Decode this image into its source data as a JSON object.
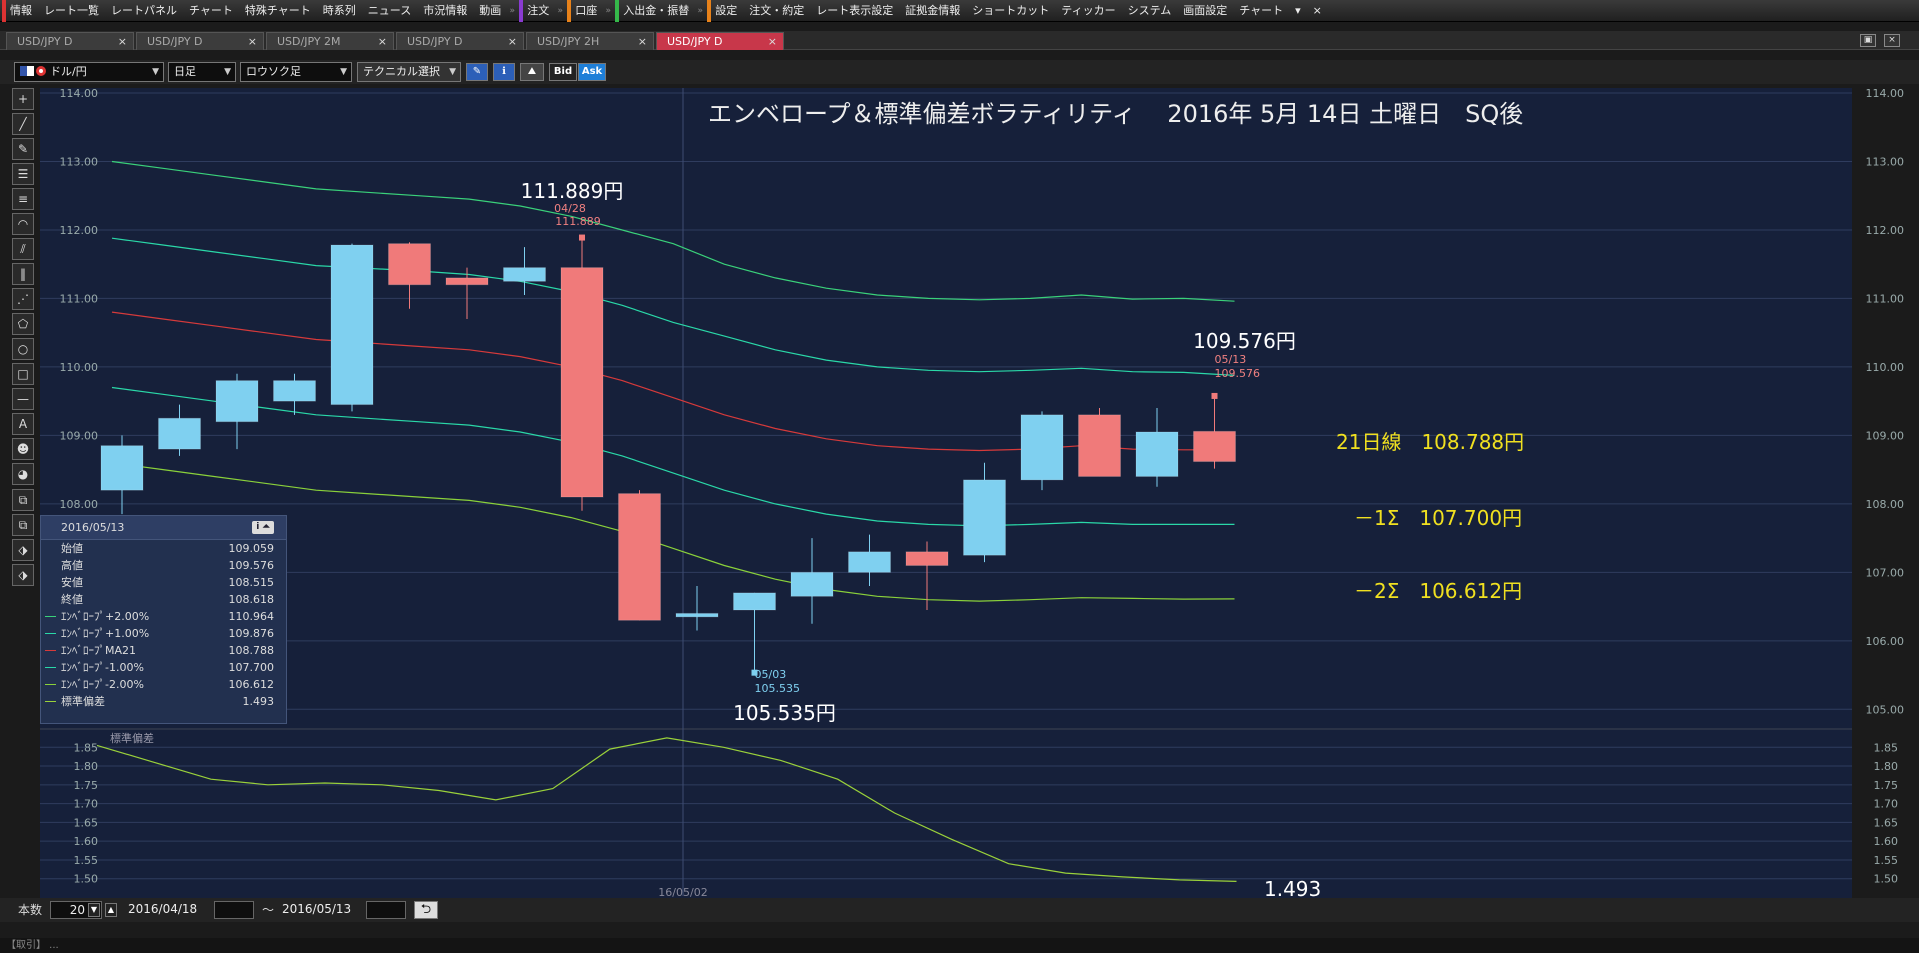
{
  "menubar": {
    "items": [
      {
        "label": "情報",
        "mark": "red"
      },
      {
        "label": "レート一覧"
      },
      {
        "label": "レートパネル"
      },
      {
        "label": "チャート"
      },
      {
        "label": "特殊チャート"
      },
      {
        "label": "時系列"
      },
      {
        "label": "ニュース"
      },
      {
        "label": "市況情報"
      },
      {
        "label": "動画"
      },
      {
        "label": "注文",
        "mark": "purple",
        "sep": true
      },
      {
        "label": "口座",
        "mark": "orange",
        "sep": true
      },
      {
        "label": "入出金・振替",
        "mark": "green",
        "sep": true
      },
      {
        "label": "設定",
        "mark": "orange",
        "sep": true
      },
      {
        "label": "注文・約定"
      },
      {
        "label": "レート表示設定"
      },
      {
        "label": "証拠金情報"
      },
      {
        "label": "ショートカット"
      },
      {
        "label": "ティッカー"
      },
      {
        "label": "システム"
      },
      {
        "label": "画面設定"
      },
      {
        "label": "チャート"
      }
    ],
    "more": "▾",
    "close": "×"
  },
  "tabs": [
    {
      "label": "USD/JPY D",
      "active": false
    },
    {
      "label": "USD/JPY D",
      "active": false
    },
    {
      "label": "USD/JPY 2M",
      "active": false
    },
    {
      "label": "USD/JPY D",
      "active": false
    },
    {
      "label": "USD/JPY 2H",
      "active": false
    },
    {
      "label": "USD/JPY D",
      "active": true
    }
  ],
  "tab_close": "×",
  "window_buttons": [
    "▣",
    "×"
  ],
  "toolbar": {
    "pair": "ドル/円",
    "timeframe": "日足",
    "chart_type": "ロウソク足",
    "technical": "テクニカル選択",
    "bid": "Bid",
    "ask": "Ask"
  },
  "tools": [
    "+",
    "╱",
    "✎",
    "☰",
    "≡",
    "◠",
    "⫽",
    "‖",
    "⋰",
    "⬠",
    "○",
    "□",
    "—",
    "A",
    "☻",
    "◕",
    "⧉",
    "⧉",
    "⬗",
    "⬗"
  ],
  "chart": {
    "title": "エンベロープ＆標準偏差ボラティリティ　 2016年 5月 14日 土曜日　SQ後",
    "annotations": {
      "high_label": "111.889円",
      "high_date": "04/28",
      "high_value": "111.889",
      "low_label": "105.535円",
      "low_date": "05/03",
      "low_value": "105.535",
      "last_label": "109.576円",
      "last_date": "05/13",
      "last_value": "109.576",
      "ma21": "21日線　108.788円",
      "minus1": "－1Σ　107.700円",
      "minus2": "－2Σ　106.612円",
      "sd_value": "1.493",
      "sd_panel_label": "標準偏差",
      "date_marker": "16/05/02"
    },
    "colors": {
      "bg": "#16203a",
      "bull": "#7fd0f0",
      "bear": "#f07a7a",
      "env_outer": "#3ad17a",
      "env_inner": "#2ad8a8",
      "ma": "#d63a3a",
      "env_lower2": "#8ad13a",
      "sd": "#9ad13a",
      "accent_yellow": "#f0e020"
    }
  },
  "chart_data": {
    "type": "candlestick",
    "price_axis": {
      "ylim": [
        104.8,
        114.0
      ],
      "ticks": [
        "114.00",
        "113.00",
        "112.00",
        "111.00",
        "110.00",
        "109.00",
        "108.00",
        "107.00",
        "106.00",
        "105.00"
      ]
    },
    "sd_axis": {
      "ylim": [
        1.47,
        1.88
      ],
      "ticks": [
        "1.85",
        "1.80",
        "1.75",
        "1.70",
        "1.65",
        "1.60",
        "1.55",
        "1.50"
      ]
    },
    "candles": [
      {
        "o": 108.2,
        "h": 109.0,
        "l": 107.85,
        "c": 108.85
      },
      {
        "o": 108.8,
        "h": 109.45,
        "l": 108.7,
        "c": 109.25
      },
      {
        "o": 109.2,
        "h": 109.9,
        "l": 108.8,
        "c": 109.8
      },
      {
        "o": 109.5,
        "h": 109.9,
        "l": 109.3,
        "c": 109.8
      },
      {
        "o": 109.45,
        "h": 111.8,
        "l": 109.35,
        "c": 111.78
      },
      {
        "o": 111.8,
        "h": 111.82,
        "l": 110.85,
        "c": 111.2
      },
      {
        "o": 111.3,
        "h": 111.45,
        "l": 110.7,
        "c": 111.2
      },
      {
        "o": 111.25,
        "h": 111.75,
        "l": 111.05,
        "c": 111.45
      },
      {
        "o": 111.45,
        "h": 111.889,
        "l": 107.9,
        "c": 108.1
      },
      {
        "o": 108.15,
        "h": 108.2,
        "l": 106.3,
        "c": 106.3
      },
      {
        "o": 106.35,
        "h": 106.8,
        "l": 106.15,
        "c": 106.4
      },
      {
        "o": 106.45,
        "h": 106.7,
        "l": 105.535,
        "c": 106.7
      },
      {
        "o": 106.65,
        "h": 107.5,
        "l": 106.25,
        "c": 107.0
      },
      {
        "o": 107.0,
        "h": 107.55,
        "l": 106.8,
        "c": 107.3
      },
      {
        "o": 107.3,
        "h": 107.45,
        "l": 106.45,
        "c": 107.1
      },
      {
        "o": 107.25,
        "h": 108.6,
        "l": 107.15,
        "c": 108.35
      },
      {
        "o": 108.35,
        "h": 109.35,
        "l": 108.2,
        "c": 109.3
      },
      {
        "o": 109.3,
        "h": 109.4,
        "l": 108.4,
        "c": 108.4
      },
      {
        "o": 108.4,
        "h": 109.4,
        "l": 108.25,
        "c": 109.05
      },
      {
        "o": 109.059,
        "h": 109.576,
        "l": 108.515,
        "c": 108.618
      }
    ],
    "envelope_plus2": [
      113.0,
      112.9,
      112.8,
      112.7,
      112.6,
      112.55,
      112.5,
      112.45,
      112.35,
      112.2,
      112.0,
      111.8,
      111.5,
      111.3,
      111.15,
      111.05,
      111.0,
      110.98,
      111.0,
      111.05,
      110.99,
      111.0,
      110.96
    ],
    "envelope_plus1": [
      111.88,
      111.78,
      111.68,
      111.58,
      111.48,
      111.44,
      111.4,
      111.35,
      111.25,
      111.1,
      110.9,
      110.65,
      110.45,
      110.25,
      110.1,
      110.0,
      109.95,
      109.93,
      109.95,
      109.98,
      109.93,
      109.92,
      109.876
    ],
    "ma21": [
      110.8,
      110.7,
      110.6,
      110.5,
      110.4,
      110.35,
      110.3,
      110.25,
      110.15,
      110.0,
      109.8,
      109.55,
      109.3,
      109.1,
      108.95,
      108.85,
      108.8,
      108.78,
      108.8,
      108.85,
      108.8,
      108.79,
      108.788
    ],
    "envelope_minus1": [
      109.7,
      109.6,
      109.5,
      109.4,
      109.3,
      109.25,
      109.2,
      109.15,
      109.05,
      108.9,
      108.7,
      108.45,
      108.2,
      108.0,
      107.85,
      107.75,
      107.7,
      107.68,
      107.7,
      107.73,
      107.7,
      107.7,
      107.7
    ],
    "envelope_minus2": [
      108.6,
      108.5,
      108.4,
      108.3,
      108.2,
      108.15,
      108.1,
      108.05,
      107.95,
      107.8,
      107.6,
      107.35,
      107.1,
      106.9,
      106.75,
      106.65,
      106.6,
      106.58,
      106.6,
      106.63,
      106.62,
      106.61,
      106.612
    ],
    "std_dev": [
      1.855,
      1.81,
      1.765,
      1.75,
      1.755,
      1.75,
      1.735,
      1.71,
      1.74,
      1.845,
      1.875,
      1.85,
      1.815,
      1.765,
      1.675,
      1.605,
      1.54,
      1.515,
      1.505,
      1.497,
      1.493
    ]
  },
  "info_panel": {
    "date": "2016/05/13",
    "rows": [
      {
        "label": "始値",
        "value": "109.059",
        "color": ""
      },
      {
        "label": "高値",
        "value": "109.576",
        "color": ""
      },
      {
        "label": "安値",
        "value": "108.515",
        "color": ""
      },
      {
        "label": "終値",
        "value": "108.618",
        "color": ""
      },
      {
        "label": "ｴﾝﾍﾞﾛｰﾌﾟ+2.00%",
        "value": "110.964",
        "color": "#3ad17a"
      },
      {
        "label": "ｴﾝﾍﾞﾛｰﾌﾟ+1.00%",
        "value": "109.876",
        "color": "#2ad8a8"
      },
      {
        "label": "ｴﾝﾍﾞﾛｰﾌﾟMA21",
        "value": "108.788",
        "color": "#d63a3a"
      },
      {
        "label": "ｴﾝﾍﾞﾛｰﾌﾟ-1.00%",
        "value": "107.700",
        "color": "#2ad8a8"
      },
      {
        "label": "ｴﾝﾍﾞﾛｰﾌﾟ-2.00%",
        "value": "106.612",
        "color": "#8ad13a"
      },
      {
        "label": "標準偏差",
        "value": "1.493",
        "color": "#9ad13a"
      }
    ]
  },
  "bottombar": {
    "count_label": "本数",
    "count_value": "20",
    "from_date": "2016/04/18",
    "tilde": "～",
    "to_date": "2016/05/13",
    "refresh": "⮌"
  },
  "statusbar": {
    "text": "【取引】 ..."
  }
}
